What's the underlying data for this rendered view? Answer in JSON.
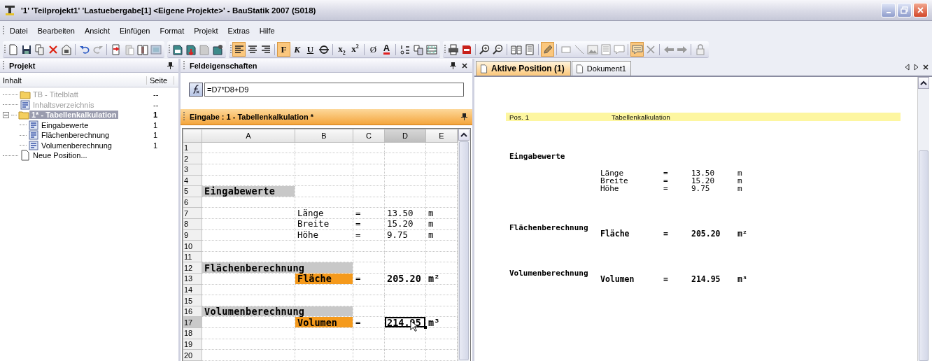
{
  "window": {
    "title": "'1' 'Teilprojekt1' 'Lastuebergabe[1] <Eigene Projekte>' - BauStatik 2007 (S018)"
  },
  "menu": [
    "Datei",
    "Bearbeiten",
    "Ansicht",
    "Einfügen",
    "Format",
    "Projekt",
    "Extras",
    "Hilfe"
  ],
  "toolbar": {
    "groups": [
      {
        "items": [
          {
            "kind": "icon",
            "on": false
          },
          {
            "kind": "icon",
            "on": false
          },
          {
            "kind": "icon",
            "on": false
          },
          {
            "kind": "icon",
            "on": false
          },
          {
            "kind": "icon",
            "on": false
          },
          {
            "kind": "separator"
          },
          {
            "kind": "icon",
            "on": false
          },
          {
            "kind": "icon",
            "on": false
          },
          {
            "kind": "separator"
          },
          {
            "kind": "icon",
            "on": false
          },
          {
            "kind": "icon",
            "on": false
          },
          {
            "kind": "icon",
            "on": false
          },
          {
            "kind": "icon",
            "on": false
          }
        ]
      },
      {
        "items": [
          {
            "kind": "icon",
            "on": false
          },
          {
            "kind": "icon",
            "on": false
          },
          {
            "kind": "icon",
            "on": false
          },
          {
            "kind": "icon",
            "on": false
          }
        ]
      },
      {
        "items": [
          {
            "kind": "icon",
            "on": true
          },
          {
            "kind": "icon",
            "on": false
          },
          {
            "kind": "icon",
            "on": false
          },
          {
            "kind": "separator"
          },
          {
            "kind": "text",
            "label": "F",
            "on": true
          },
          {
            "kind": "text",
            "label": "K",
            "on": false
          },
          {
            "kind": "text",
            "label": "U",
            "on": false
          },
          {
            "kind": "icon",
            "on": false
          },
          {
            "kind": "separator"
          },
          {
            "kind": "text",
            "label": "x$_{2}$",
            "on": false
          },
          {
            "kind": "text",
            "label": "x$^{2}$",
            "on": false
          },
          {
            "kind": "separator"
          },
          {
            "kind": "text",
            "label": "Ø",
            "on": false
          },
          {
            "kind": "text",
            "label": "A",
            "on": false
          },
          {
            "kind": "separator"
          },
          {
            "kind": "icon",
            "on": false
          },
          {
            "kind": "icon",
            "on": false
          },
          {
            "kind": "icon",
            "on": false
          }
        ]
      },
      {
        "items": [
          {
            "kind": "icon",
            "on": false
          },
          {
            "kind": "icon",
            "on": false
          },
          {
            "kind": "separator"
          },
          {
            "kind": "icon",
            "on": false
          },
          {
            "kind": "icon",
            "on": false
          },
          {
            "kind": "separator"
          },
          {
            "kind": "icon",
            "on": false
          },
          {
            "kind": "icon",
            "on": false
          },
          {
            "kind": "separator"
          },
          {
            "kind": "icon",
            "on": true
          },
          {
            "kind": "separator"
          },
          {
            "kind": "icon",
            "on": false
          },
          {
            "kind": "icon",
            "on": false
          },
          {
            "kind": "icon",
            "on": false
          },
          {
            "kind": "icon",
            "on": false
          },
          {
            "kind": "icon",
            "on": false
          },
          {
            "kind": "separator"
          },
          {
            "kind": "icon",
            "on": true
          },
          {
            "kind": "icon",
            "on": false
          },
          {
            "kind": "separator"
          },
          {
            "kind": "icon",
            "on": false
          },
          {
            "kind": "icon",
            "on": false
          },
          {
            "kind": "separator"
          },
          {
            "kind": "icon",
            "on": false
          }
        ]
      }
    ]
  },
  "project": {
    "title": "Projekt",
    "columns": [
      "Inhalt",
      "Seite"
    ],
    "tree": [
      {
        "label": "TB - Titelblatt",
        "page": "--",
        "kind": "folder",
        "disabled": true,
        "selected": false
      },
      {
        "label": "Inhaltsverzeichnis",
        "page": "--",
        "kind": "document",
        "disabled": true,
        "selected": false
      },
      {
        "label": "1* - Tabellenkalkulation",
        "page": "1",
        "kind": "folder",
        "disabled": false,
        "selected": true,
        "expanded": true,
        "children": [
          {
            "label": "Eingabewerte",
            "page": "1",
            "kind": "document",
            "disabled": false,
            "selected": false
          },
          {
            "label": "Flächenberechnung",
            "page": "1",
            "kind": "document",
            "disabled": false,
            "selected": false
          },
          {
            "label": "Volumenberechnung",
            "page": "1",
            "kind": "document",
            "disabled": false,
            "selected": false
          }
        ]
      },
      {
        "label": "Neue Position...",
        "kind": "new",
        "disabled": false,
        "selected": false
      }
    ]
  },
  "properties": {
    "title": "Feldeigenschaften",
    "formula": "=D7*D8+D9"
  },
  "sheet": {
    "title": "Eingabe : 1 - Tabellenkalkulation *",
    "columns": [
      {
        "label": "A",
        "selected": false
      },
      {
        "label": "B",
        "selected": false
      },
      {
        "label": "C",
        "selected": false
      },
      {
        "label": "D",
        "selected": true
      },
      {
        "label": "E",
        "selected": false
      }
    ],
    "rows": [
      {
        "number": "1",
        "selected": false
      },
      {
        "number": "2",
        "selected": false
      },
      {
        "number": "3",
        "selected": false
      },
      {
        "number": "4",
        "selected": false
      },
      {
        "number": "5",
        "selected": false,
        "cells": {
          "A": {
            "text": "Eingabewerte",
            "kind": "heading",
            "selected": false
          }
        }
      },
      {
        "number": "6",
        "selected": false
      },
      {
        "number": "7",
        "selected": false,
        "cells": {
          "B": {
            "text": "Länge",
            "kind": "plain",
            "selected": false
          },
          "C": {
            "text": "=",
            "kind": "plain",
            "selected": false
          },
          "D": {
            "text": "13.50",
            "kind": "plain",
            "selected": false
          },
          "E": {
            "text": "m",
            "kind": "plain",
            "selected": false
          }
        }
      },
      {
        "number": "8",
        "selected": false,
        "cells": {
          "B": {
            "text": "Breite",
            "kind": "plain",
            "selected": false
          },
          "C": {
            "text": "=",
            "kind": "plain",
            "selected": false
          },
          "D": {
            "text": "15.20",
            "kind": "plain",
            "selected": false
          },
          "E": {
            "text": "m",
            "kind": "plain",
            "selected": false
          }
        }
      },
      {
        "number": "9",
        "selected": false,
        "cells": {
          "B": {
            "text": "Höhe",
            "kind": "plain",
            "selected": false
          },
          "C": {
            "text": "=",
            "kind": "plain",
            "selected": false
          },
          "D": {
            "text": "9.75",
            "kind": "plain",
            "selected": false
          },
          "E": {
            "text": "m",
            "kind": "plain",
            "selected": false
          }
        }
      },
      {
        "number": "10",
        "selected": false
      },
      {
        "number": "11",
        "selected": false
      },
      {
        "number": "12",
        "selected": false,
        "cells": {
          "A": {
            "text": "Flächenberechnung",
            "kind": "wide-heading",
            "selected": false
          }
        }
      },
      {
        "number": "13",
        "selected": false,
        "cells": {
          "B": {
            "text": "Fläche",
            "kind": "highlight",
            "selected": false
          },
          "C": {
            "text": "=",
            "kind": "plain",
            "selected": false
          },
          "D": {
            "text": "205.20",
            "kind": "bold",
            "selected": false
          },
          "E": {
            "text": "m²",
            "kind": "bold",
            "selected": false
          }
        }
      },
      {
        "number": "14",
        "selected": false
      },
      {
        "number": "15",
        "selected": false
      },
      {
        "number": "16",
        "selected": false,
        "cells": {
          "A": {
            "text": "Volumenberechnung",
            "kind": "wide-heading",
            "selected": false
          }
        }
      },
      {
        "number": "17",
        "selected": true,
        "cells": {
          "B": {
            "text": "Volumen",
            "kind": "highlight",
            "selected": false
          },
          "C": {
            "text": "=",
            "kind": "plain",
            "selected": false
          },
          "D": {
            "text": "214.95",
            "kind": "bold",
            "selected": true
          },
          "E": {
            "text": "m³",
            "kind": "bold",
            "selected": false
          }
        }
      },
      {
        "number": "18",
        "selected": false
      },
      {
        "number": "19",
        "selected": false
      },
      {
        "number": "20",
        "selected": false
      }
    ]
  },
  "document_tabs": [
    {
      "label": "Aktive Position (1)",
      "selected": true
    },
    {
      "label": "Dokument1",
      "selected": false
    }
  ],
  "document": {
    "header": {
      "position": "Pos. 1",
      "title": "Tabellenkalkulation"
    },
    "sections": [
      {
        "title": "Eingabewerte",
        "rows": [
          {
            "label": "Länge",
            "sign": "=",
            "value": "13.50",
            "unit": "m",
            "emphasis": false
          },
          {
            "label": "Breite",
            "sign": "=",
            "value": "15.20",
            "unit": "m",
            "emphasis": false
          },
          {
            "label": "Höhe",
            "sign": "=",
            "value": "9.75",
            "unit": "m",
            "emphasis": false
          }
        ]
      },
      {
        "title": "Flächenberechnung",
        "rows": [
          {
            "label": "Fläche",
            "sign": "=",
            "value": "205.20",
            "unit": "m²",
            "emphasis": true
          }
        ]
      },
      {
        "title": "Volumenberechnung",
        "rows": [
          {
            "label": "Volumen",
            "sign": "=",
            "value": "214.95",
            "unit": "m³",
            "emphasis": true
          }
        ]
      }
    ]
  }
}
